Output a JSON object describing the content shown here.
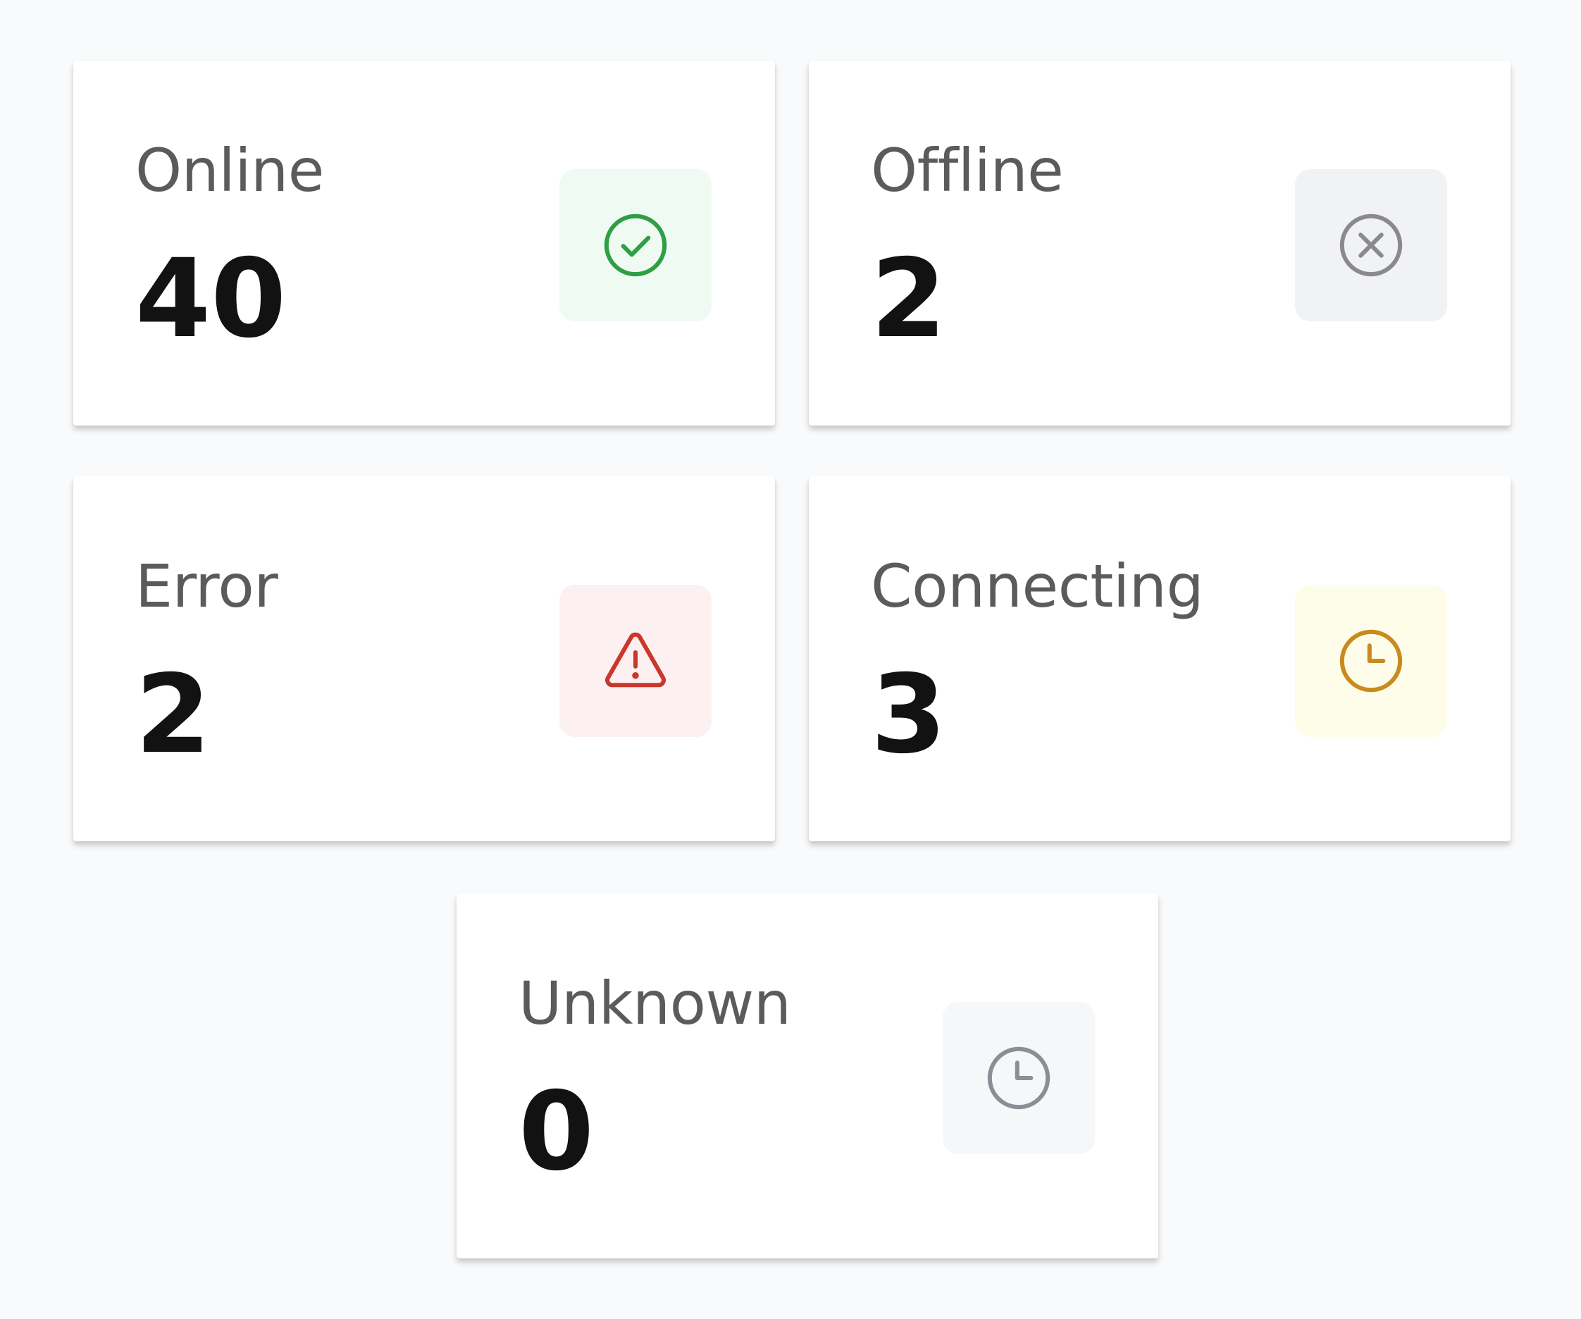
{
  "status_cards": [
    {
      "label": "Online",
      "value": "40",
      "icon": "check-circle-icon",
      "color": "#2f9e44",
      "bg": "#effbf2"
    },
    {
      "label": "Offline",
      "value": "2",
      "icon": "x-circle-icon",
      "color": "#8a8a8e",
      "bg": "#f1f2f4"
    },
    {
      "label": "Error",
      "value": "2",
      "icon": "warning-triangle-icon",
      "color": "#c9372c",
      "bg": "#fcf0f0"
    },
    {
      "label": "Connecting",
      "value": "3",
      "icon": "clock-icon",
      "color": "#c98a1e",
      "bg": "#fdfde9"
    },
    {
      "label": "Unknown",
      "value": "0",
      "icon": "clock-icon",
      "color": "#8a8f96",
      "bg": "#f6f7f8"
    }
  ]
}
